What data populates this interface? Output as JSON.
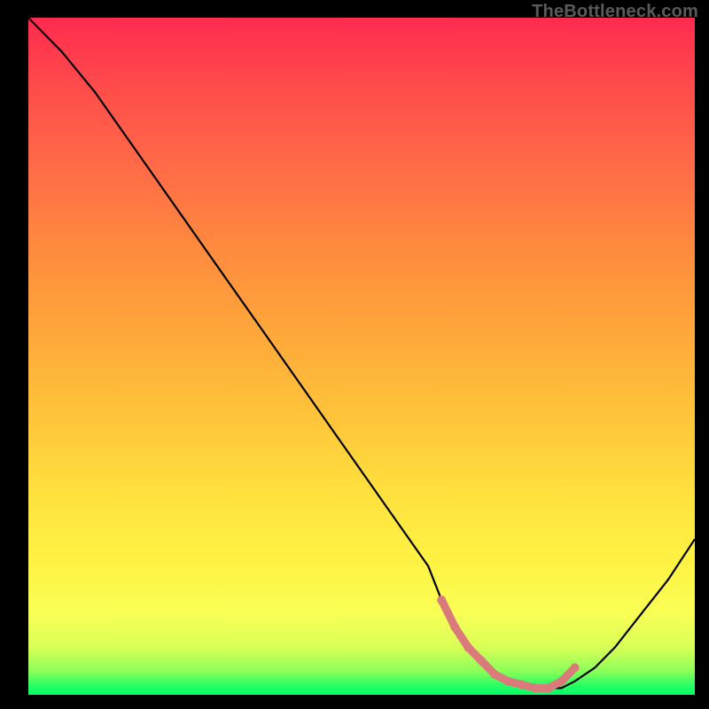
{
  "watermark": {
    "text": "TheBottleneck.com"
  },
  "chart_data": {
    "type": "line",
    "title": "",
    "xlabel": "",
    "ylabel": "",
    "xlim": [
      0,
      100
    ],
    "ylim": [
      0,
      100
    ],
    "grid": false,
    "series": [
      {
        "name": "bottleneck-curve",
        "color": "#000000",
        "x": [
          0,
          5,
          10,
          15,
          20,
          25,
          30,
          35,
          40,
          45,
          50,
          55,
          60,
          62,
          65,
          68,
          72,
          76,
          80,
          82,
          85,
          88,
          92,
          96,
          100
        ],
        "y": [
          100,
          95,
          89,
          82,
          75,
          68,
          61,
          54,
          47,
          40,
          33,
          26,
          19,
          14,
          9,
          5,
          2,
          1,
          1,
          2,
          4,
          7,
          12,
          17,
          23
        ]
      }
    ],
    "highlight": {
      "name": "valley-highlight",
      "color": "#db7a7a",
      "x": [
        62,
        64,
        66,
        68,
        70,
        72,
        74,
        76,
        78,
        80,
        82
      ],
      "y": [
        14,
        10,
        7,
        5,
        3,
        2,
        1.5,
        1,
        1,
        2,
        4
      ]
    },
    "background_gradient": {
      "top": "#ff2a4f",
      "mid1": "#ffa63a",
      "mid2": "#ffe03e",
      "bottom": "#00ff66"
    }
  }
}
